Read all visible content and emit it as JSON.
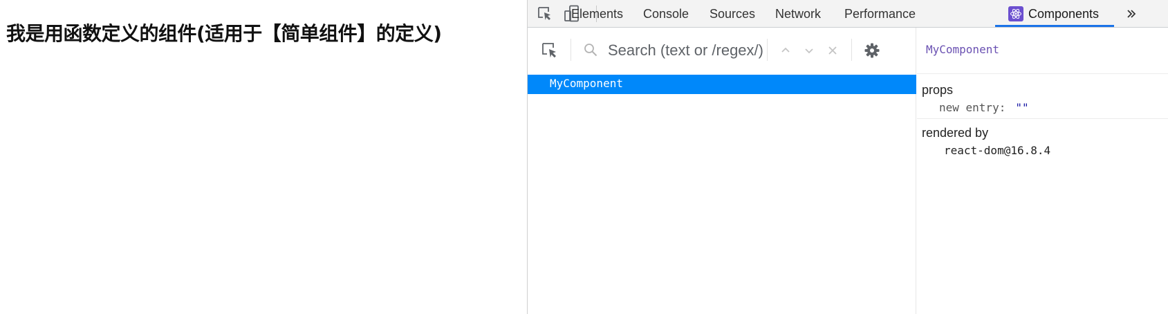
{
  "page": {
    "heading": "我是用函数定义的组件(适用于【简单组件】的定义)"
  },
  "devtools": {
    "toolbar": {
      "inspect_icon": "inspect-element-icon",
      "device_icon": "device-toolbar-icon"
    },
    "tabs": [
      {
        "label": "Elements"
      },
      {
        "label": "Console"
      },
      {
        "label": "Sources"
      },
      {
        "label": "Network"
      },
      {
        "label": "Performance"
      },
      {
        "label": "Components",
        "active": true
      }
    ],
    "more_tabs_icon": "double-chevron-right-icon",
    "accent_color": "#1a73e8"
  },
  "components_panel": {
    "search": {
      "placeholder": "Search (text or /regex/)"
    },
    "tree": [
      {
        "label": "MyComponent",
        "selected": true
      }
    ],
    "selected_color": "#0088fa",
    "inspector": {
      "component_name": "MyComponent",
      "props_title": "props",
      "props": [
        {
          "key": "new entry",
          "colon": ":",
          "value": "\"\""
        }
      ],
      "rendered_by_title": "rendered by",
      "rendered_by": [
        "react-dom@16.8.4"
      ]
    }
  }
}
